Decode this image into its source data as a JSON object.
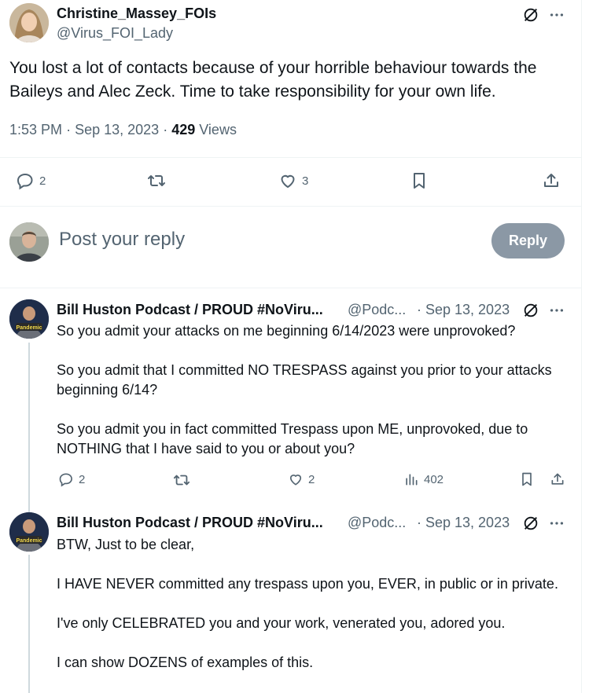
{
  "main_tweet": {
    "author_name": "Christine_Massey_FOIs",
    "author_handle": "@Virus_FOI_Lady",
    "text": "You lost a lot of contacts because of your horrible behaviour towards the Baileys and Alec Zeck.  Time to take responsibility for your own life.",
    "time": "1:53 PM",
    "date": "Sep 13, 2023",
    "views_count": "429",
    "views_label": "Views",
    "reply_count": "2",
    "like_count": "3"
  },
  "composer": {
    "placeholder": "Post your reply",
    "reply_button": "Reply"
  },
  "replies": [
    {
      "author_name": "Bill Huston Podcast / PROUD #NoViru...",
      "author_handle": "@Podc...",
      "date": "· Sep 13, 2023",
      "avatar_text": "Pandemic",
      "paragraphs": [
        "So you admit your attacks on me beginning 6/14/2023 were unprovoked?",
        "So you admit that I committed NO TRESPASS against you prior to your attacks beginning 6/14?",
        "So you admit you in fact committed Trespass upon ME, unprovoked, due to NOTHING that I have said to you or about you?"
      ],
      "reply_count": "2",
      "like_count": "2",
      "views": "402"
    },
    {
      "author_name": "Bill Huston Podcast / PROUD #NoViru...",
      "author_handle": "@Podc...",
      "date": "· Sep 13, 2023",
      "avatar_text": "Pandemic",
      "paragraphs": [
        "BTW, Just to be clear,",
        "I HAVE NEVER committed any trespass upon you, EVER, in public or in private.",
        "I've only CELEBRATED you and your work, venerated you, adored you.",
        "I can show DOZENS of examples of this."
      ]
    }
  ],
  "icons": {
    "reply": "speech-bubble-icon",
    "repost": "repost-arrows-icon",
    "like": "heart-icon",
    "bookmark": "bookmark-icon",
    "share": "share-upload-icon",
    "views": "bar-chart-icon",
    "grok": "grok-slash-circle-icon",
    "more": "ellipsis-icon"
  }
}
